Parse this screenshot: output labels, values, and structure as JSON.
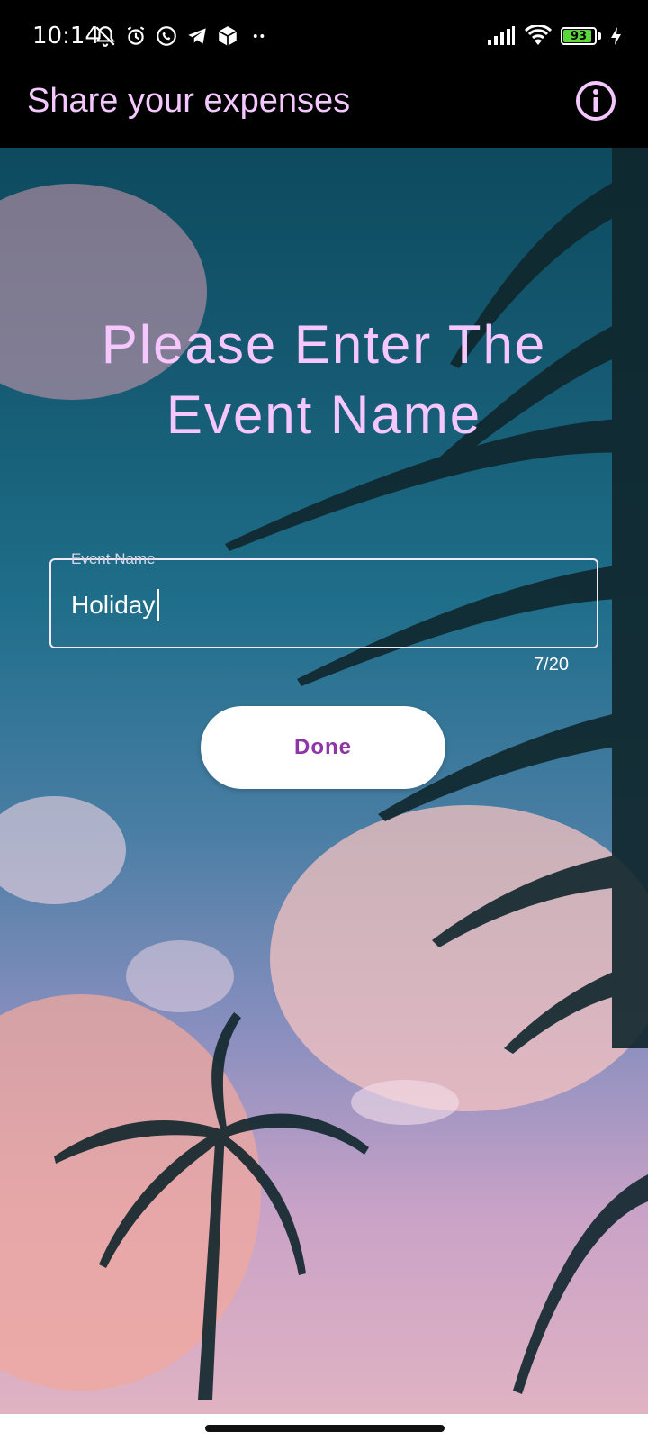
{
  "status_bar": {
    "time": "10:14",
    "battery_level": "93",
    "battery_fill_fraction": 0.93,
    "icons_left": [
      "bell-off-icon",
      "alarm-icon",
      "whatsapp-icon",
      "telegram-icon",
      "package-icon",
      "more-dots-icon"
    ],
    "icons_right": [
      "signal-icon",
      "wifi-icon",
      "battery-icon",
      "charging-icon"
    ]
  },
  "app_bar": {
    "title": "Share your expenses",
    "info_icon": "info-icon"
  },
  "main": {
    "heading": "Please Enter The Event Name",
    "event_name_field": {
      "label": "Event Name",
      "value": "Holiday",
      "counter": "7/20"
    },
    "done_label": "Done"
  },
  "colors": {
    "title": "#f4c8ff",
    "heading": "#f6c6ff",
    "button_text": "#8f35a8",
    "button_bg": "#ffffff",
    "battery": "#5cd63a"
  }
}
